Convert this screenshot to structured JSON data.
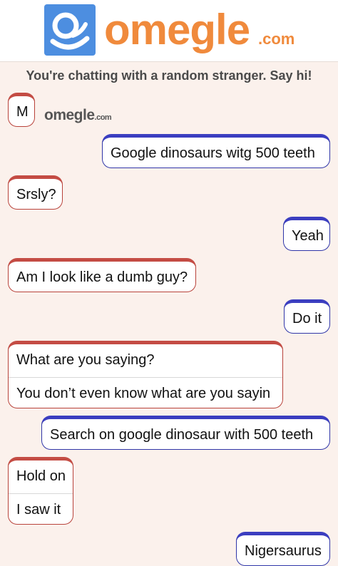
{
  "header": {
    "logo_word": "omegle",
    "logo_tld": ".com"
  },
  "notice": "You're chatting with a random stranger. Say hi!",
  "mini_logo": {
    "word": "omegle",
    "tld": ".com"
  },
  "messages": [
    {
      "from": "stranger",
      "lines": [
        "M"
      ]
    },
    {
      "from": "you",
      "lines": [
        "Google dinosaurs witg 500 teeth"
      ]
    },
    {
      "from": "stranger",
      "lines": [
        "Srsly?"
      ]
    },
    {
      "from": "you",
      "lines": [
        "Yeah"
      ]
    },
    {
      "from": "stranger",
      "lines": [
        "Am I look like a dumb guy?"
      ]
    },
    {
      "from": "you",
      "lines": [
        "Do it"
      ]
    },
    {
      "from": "stranger",
      "lines": [
        "What are you saying?",
        "You don’t even know what are you sayin"
      ]
    },
    {
      "from": "you",
      "lines": [
        "Search on google dinosaur with 500 teeth"
      ]
    },
    {
      "from": "stranger",
      "lines": [
        "Hold on",
        "I saw it"
      ]
    },
    {
      "from": "you",
      "lines": [
        "Nigersaurus"
      ]
    }
  ],
  "colors": {
    "accent": "#f08a3c",
    "logo_blue": "#4d8ee0",
    "stranger": "#b8423a",
    "you": "#2f35a8"
  }
}
